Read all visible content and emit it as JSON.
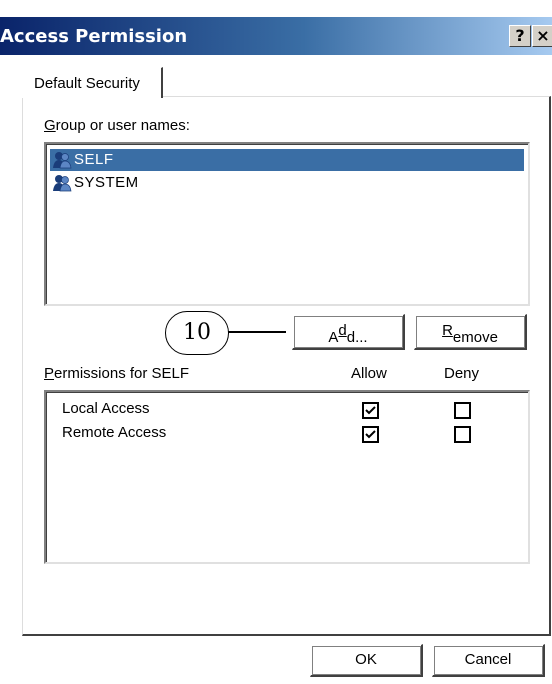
{
  "window": {
    "title": "Access Permission",
    "help_button": "?",
    "close_button": "×"
  },
  "tabs": [
    {
      "label": "Default Security"
    }
  ],
  "groups": {
    "label_prefix": "G",
    "label_rest": "roup or user names:",
    "items": [
      {
        "name": "SELF",
        "selected": true,
        "icon": "group-users-icon"
      },
      {
        "name": "SYSTEM",
        "selected": false,
        "icon": "group-users-icon"
      }
    ]
  },
  "callout": {
    "number": "10"
  },
  "buttons": {
    "add_before": "A",
    "add_mnemonic": "d",
    "add_after": "d...",
    "remove_mnemonic": "R",
    "remove_rest": "emove",
    "ok": "OK",
    "cancel": "Cancel"
  },
  "permissions": {
    "label_prefix": "P",
    "label_rest": "ermissions for SELF",
    "col_allow": "Allow",
    "col_deny": "Deny",
    "rows": [
      {
        "name": "Local Access",
        "allow": true,
        "deny": false
      },
      {
        "name": "Remote Access",
        "allow": true,
        "deny": false
      }
    ]
  },
  "colors": {
    "title_start": "#0a246a",
    "title_end": "#a6caf0",
    "selection": "#3a6ea5"
  }
}
